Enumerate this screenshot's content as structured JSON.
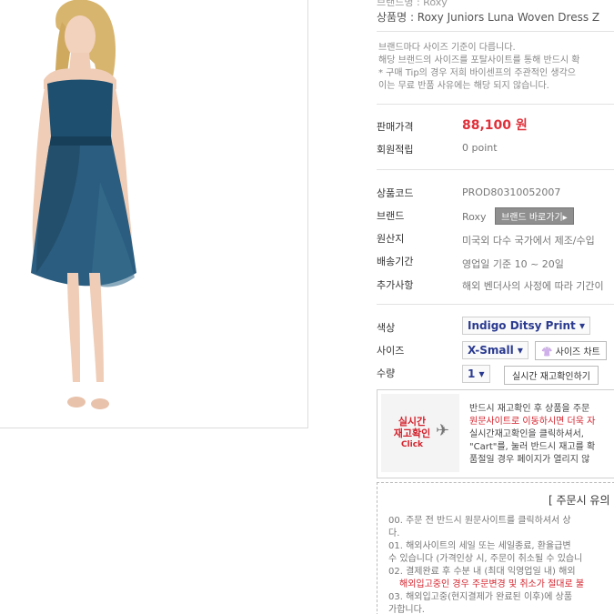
{
  "product": {
    "top_cut_text": "브랜드명 : Roxy",
    "name_label": "상품명",
    "name": ": Roxy Juniors Luna Woven Dress Z",
    "image_alt": "strapless blue dress model"
  },
  "notice": [
    "브랜드마다 사이즈 기준이 다릅니다.",
    "해당 브랜드의 사이즈를 포탈사이트를 통해 반드시 확",
    "* 구매 Tip의 경우 저희 바이센프의 주관적인 생각으",
    "이는 무료 반품 사유에는 해당 되지 않습니다."
  ],
  "price": {
    "label": "판매가격",
    "value": "88,100 원"
  },
  "points": {
    "label": "회원적립",
    "value": "0 point"
  },
  "info": {
    "code_label": "상품코드",
    "code": "PROD80310052007",
    "brand_label": "브랜드",
    "brand": "Roxy",
    "brand_button": "브랜드 바로가기▸",
    "origin_label": "원산지",
    "origin": "미국외 다수 국가에서 제조/수입",
    "shipping_label": "배송기간",
    "shipping": "영업일 기준 10 ~ 20일",
    "extra_label": "추가사항",
    "extra": "해외 벤더사의 사정에 따라 기간이"
  },
  "options": {
    "color_label": "색상",
    "color_value": "Indigo Ditsy Print ▾",
    "size_label": "사이즈",
    "size_value": "X-Small ▾",
    "size_chart": "사이즈 차트",
    "qty_label": "수량",
    "qty_value": "1 ▾",
    "stock_button": "실시간 재고확인하기"
  },
  "stock_banner": {
    "title1": "실시간",
    "title2": "재고확인",
    "click": "Click",
    "lines": [
      "반드시 재고확인 후 상품을 주문",
      "원문사이트로 이동하시면 더욱 자",
      "실시간재고확인을 클릭하셔서,",
      "\"Cart\"를, 눌러 반드시 재고를 확",
      "품절일 경우 페이지가 열리지 않"
    ]
  },
  "order_notice": {
    "title": "[ 주문시 유의",
    "lines": [
      "00.    주문 전 반드시 원문사이트를 클릭하셔서 상",
      "다.",
      "01.    해외사이트의 세일 또는 세일종료, 환율급변",
      "수 있습니다 (가격인상 시, 주문이 취소될 수 있습니",
      "02.    결제완료 후 수분 내 (최대 익영업일 내) 해외",
      "해외입고중인 경우 주문변경 및 취소가 절대로 불",
      "03.    해외입고중(현지결제가 완료된 이후)에 상품",
      "가합니다."
    ]
  },
  "colors": {
    "price_red": "#e0303a",
    "select_blue": "#2a3a90",
    "accent_red": "#d4222c"
  }
}
